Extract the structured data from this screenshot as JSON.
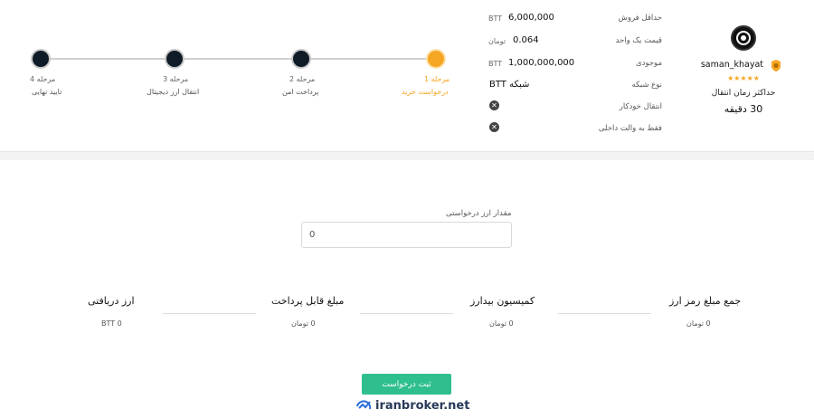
{
  "seller": {
    "name": "saman_khayat",
    "stars": "★★★★★",
    "transfer_label": "حداکثر زمان انتقال",
    "transfer_value": "30 دقیقه"
  },
  "info": {
    "min_sale_label": "حداقل فروش",
    "min_sale_value": "6,000,000",
    "min_sale_unit": "BTT",
    "unit_price_label": "قیمت یک واحد",
    "unit_price_value": "0.064",
    "unit_price_unit": "تومان",
    "stock_label": "موجودی",
    "stock_value": "1,000,000,000",
    "stock_unit": "BTT",
    "network_label": "نوع شبکه",
    "network_value": "شبکه BTT",
    "auto_transfer_label": "انتقال خودکار",
    "internal_wallet_label": "فقط به والت داخلی"
  },
  "steps": [
    {
      "num": "مرحله 1",
      "title": "درخواست خرید"
    },
    {
      "num": "مرحله 2",
      "title": "پرداخت امن"
    },
    {
      "num": "مرحله 3",
      "title": "انتقال ارز دیجیتال"
    },
    {
      "num": "مرحله 4",
      "title": "تایید نهایی"
    }
  ],
  "form": {
    "amount_label": "مقدار ارز درخواستی",
    "amount_value": "0"
  },
  "summary": {
    "total_title": "جمع مبلغ رمز ارز",
    "total_value": "0 تومان",
    "commission_title": "کمیسیون بیدارز",
    "commission_value": "0 تومان",
    "payable_title": "مبلغ قابل پرداخت",
    "payable_value": "0 تومان",
    "received_title": "ارز دریافتی",
    "received_value": "BTT 0"
  },
  "submit_label": "ثبت درخواست",
  "watermark": "iranbroker.net",
  "colors": {
    "accent": "#f5a623",
    "submit": "#2fbf8f",
    "step_dot": "#0f1b26"
  }
}
